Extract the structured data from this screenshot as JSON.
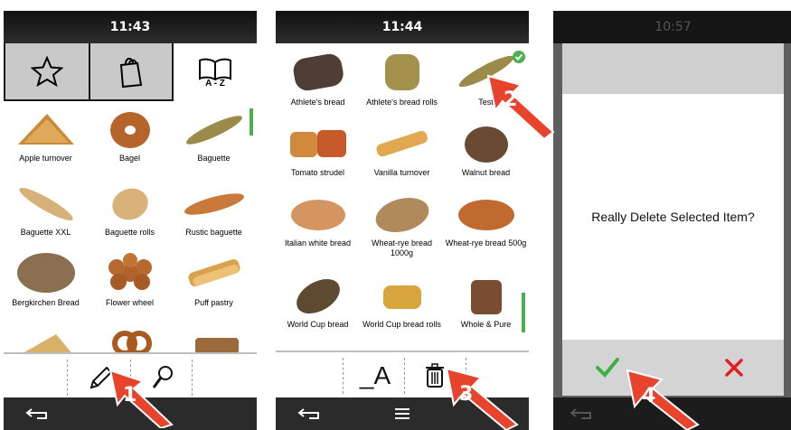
{
  "screen1": {
    "time": "11:43",
    "tabs": {
      "favorites_icon": "star-icon",
      "categories_icon": "shopping-bag-icon",
      "az_icon": "open-book-icon",
      "az_label": "A - Z"
    },
    "items": [
      {
        "label": "Apple turnover"
      },
      {
        "label": "Bagel"
      },
      {
        "label": "Baguette"
      },
      {
        "label": "Baguette XXL"
      },
      {
        "label": "Baguette rolls"
      },
      {
        "label": "Rustic baguette"
      },
      {
        "label": "Bergkirchen Bread"
      },
      {
        "label": "Flower wheel"
      },
      {
        "label": "Puff pastry"
      }
    ],
    "toolbar": {
      "edit_icon": "pencil-icon",
      "search_icon": "magnifier-icon"
    },
    "step_number": "1"
  },
  "screen2": {
    "time": "11:44",
    "items": [
      {
        "label": "Athlete's bread"
      },
      {
        "label": "Athlete's bread rolls"
      },
      {
        "label": "Test"
      },
      {
        "label": "Tomato strudel"
      },
      {
        "label": "Vanilla turnover"
      },
      {
        "label": "Walnut bread"
      },
      {
        "label": "Italian white bread"
      },
      {
        "label": "Wheat-rye bread 1000g"
      },
      {
        "label": "Wheat-rye bread 500g"
      },
      {
        "label": "World Cup bread"
      },
      {
        "label": "World Cup bread rolls"
      },
      {
        "label": "Whole & Pure"
      }
    ],
    "toolbar": {
      "rename_label": "_A",
      "delete_icon": "trash-icon"
    },
    "step_number_selection": "2",
    "step_number_delete": "3"
  },
  "screen3": {
    "time": "10:57",
    "dialog_message": "Really Delete Selected Item?",
    "confirm_icon": "checkmark-icon",
    "cancel_icon": "cross-icon",
    "step_number": "4",
    "colors": {
      "confirm": "#3cb043",
      "cancel": "#e02020"
    }
  },
  "colors": {
    "arrow": "#e8432d",
    "scroll_indicator": "#4caf50",
    "selected_check": "#4caf50"
  }
}
